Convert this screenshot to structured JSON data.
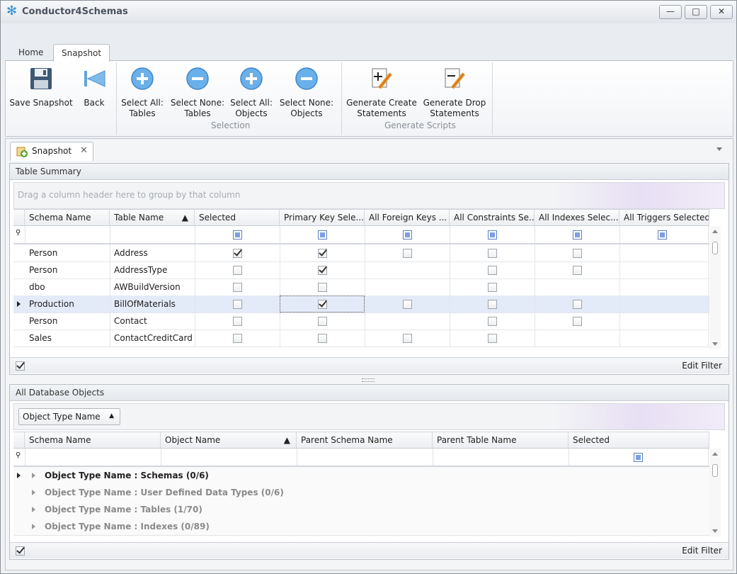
{
  "app": {
    "title": "Conductor4Schemas"
  },
  "window_controls": {
    "minimize": "—",
    "maximize": "□",
    "close": "✕"
  },
  "ribbon": {
    "tabs": [
      {
        "label": "Home"
      },
      {
        "label": "Snapshot",
        "active": true
      }
    ],
    "buttons": {
      "save_snapshot": "Save Snapshot",
      "back": "Back",
      "select_all_tables_1": "Select All:",
      "select_all_tables_2": "Tables",
      "select_none_tables_1": "Select None:",
      "select_none_tables_2": "Tables",
      "select_all_objects_1": "Select All:",
      "select_all_objects_2": "Objects",
      "select_none_objects_1": "Select None:",
      "select_none_objects_2": "Objects",
      "gen_create_1": "Generate Create",
      "gen_create_2": "Statements",
      "gen_drop_1": "Generate Drop",
      "gen_drop_2": "Statements"
    },
    "groups": {
      "selection": "Selection",
      "generate_scripts": "Generate Scripts"
    }
  },
  "document_tab": {
    "label": "Snapshot"
  },
  "table_summary": {
    "title": "Table Summary",
    "group_prompt": "Drag a column header here to group by that column",
    "columns": [
      "Schema Name",
      "Table Name",
      "Selected",
      "Primary Key Sele...",
      "All Foreign Keys ...",
      "All Constraints Se...",
      "All Indexes Selec...",
      "All Triggers Selected"
    ],
    "rows": [
      {
        "schema": "Person",
        "table": "Address",
        "checks": [
          "checked",
          "checked",
          "empty",
          "empty",
          "empty",
          "none"
        ]
      },
      {
        "schema": "Person",
        "table": "AddressType",
        "checks": [
          "empty",
          "checked",
          "none",
          "empty",
          "empty",
          "none"
        ]
      },
      {
        "schema": "dbo",
        "table": "AWBuildVersion",
        "checks": [
          "empty",
          "empty",
          "none",
          "empty",
          "none",
          "none"
        ]
      },
      {
        "schema": "Production",
        "table": "BillOfMaterials",
        "checks": [
          "empty",
          "checked",
          "empty",
          "empty",
          "empty",
          "none"
        ],
        "selected": true
      },
      {
        "schema": "Person",
        "table": "Contact",
        "checks": [
          "empty",
          "empty",
          "none",
          "empty",
          "empty",
          "none"
        ]
      },
      {
        "schema": "Sales",
        "table": "ContactCreditCard",
        "checks": [
          "empty",
          "empty",
          "empty",
          "empty",
          "none",
          "none"
        ]
      }
    ],
    "edit_filter": "Edit Filter"
  },
  "db_objects": {
    "title": "All Database Objects",
    "group_chip": "Object Type Name",
    "columns": [
      "Schema Name",
      "Object Name",
      "Parent Schema Name",
      "Parent Table Name",
      "Selected"
    ],
    "groups": [
      "Object Type Name : Schemas (0/6)",
      "Object Type Name : User Defined Data Types (0/6)",
      "Object Type Name : Tables (1/70)",
      "Object Type Name : Indexes (0/89)"
    ],
    "edit_filter": "Edit Filter"
  },
  "colors": {
    "accent": "#2f8fd6",
    "selected_row": "#e3eaf8",
    "indeterminate": "#7ea0e0"
  }
}
